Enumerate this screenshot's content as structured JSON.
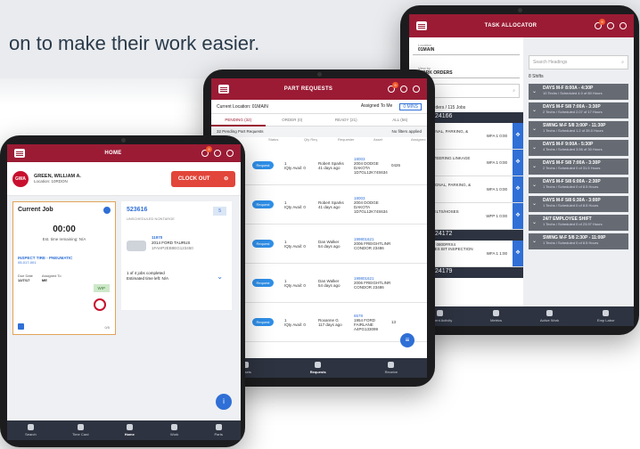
{
  "hero": {
    "text": "on to make their work easier."
  },
  "task_allocator": {
    "title": "TASK ALLOCATOR",
    "location_label": "Location",
    "location_value": "01MAIN",
    "view_by_label": "View by",
    "view_by_value": "WORK ORDERS",
    "search_left": "dings",
    "search_right_placeholder": "Search Headings",
    "work_order_count": "12 Work Orders / 115 Jobs",
    "shifts_count": "8 Shifts",
    "order_ids": [
      "or ID: 524166",
      "or ID: 524172",
      "or ID: 524179"
    ],
    "order_rows": [
      {
        "l1": "FORD E150",
        "l2": "REPAIR SIGNAL, PARKING, &",
        "l3": "WFA 1 0:00"
      },
      {
        "l1": "FORD E150",
        "l2": "INSPECT STEERING LINKAGE",
        "l3": "WFA 1 0:00"
      },
      {
        "l1": "FORD E150",
        "l2": "INSPECT SIGNAL, PARKING, &",
        "l3": "WFA 1 0:00"
      },
      {
        "l1": "FORD E150",
        "l2": "INSPECT BELTS/HOSES",
        "l3": "WFP 1 0:00"
      },
      {
        "l1": "RATOLIGHT 0800FRX4",
        "l2": "PM SERVICES BIT INSPECTION",
        "l3": "WFA 1 1:00"
      }
    ],
    "shifts": [
      {
        "name": "DAYS M-F 8:00A - 4:30P",
        "detail": "10 Techs / Scheduled 4.0 of 80 Hours"
      },
      {
        "name": "DAYS M-F 5/8 7:00A - 3:30P",
        "detail": "2 Techs / Scheduled 2.07 of 17 Hours"
      },
      {
        "name": "SWING M-F 5/8 3:00P - 11:30P",
        "detail": "1 Techs / Scheduled 1.2 of 35.0 Hours"
      },
      {
        "name": "DAYS M-F 9:00A - 5:30P",
        "detail": "4 Techs / Scheduled 3.56 of 30 Hours"
      },
      {
        "name": "DAYS M-F 5/8 7:00A - 3:30P",
        "detail": "2 Techs / Scheduled 0 of 31.5 Hours"
      },
      {
        "name": "DAYS M-F 5/8 6:00A - 2:30P",
        "detail": "1 Techs / Scheduled 0 of 8.5 Hours"
      },
      {
        "name": "DAYS M-F 5/8 6:30A - 3:00P",
        "detail": "1 Techs / Scheduled 0 of 8.5 Hours"
      },
      {
        "name": "24/7 EMPLOYEE SHIFT",
        "detail": "1 Techs / Scheduled 0 of 23.97 Hours"
      },
      {
        "name": "SWING M-F 5/8 2:30P - 11:00P",
        "detail": "1 Techs / Scheduled 0 of 8.5 Hours"
      }
    ],
    "nav": [
      "Current Activity",
      "Metrics",
      "Active Work",
      "Emp Labor"
    ]
  },
  "part_requests": {
    "title": "PART REQUESTS",
    "location": "Current Location: 01MAIN",
    "assigned": "Assigned To Me",
    "sync": "0 MINS",
    "tabs": [
      "PENDING (32)",
      "ORDER (0)",
      "READY (21)",
      "ALL (56)"
    ],
    "sub_left": "32 Pending Part Requests",
    "sub_right": "No filters applied",
    "headers": [
      "Status",
      "Qty Req",
      "Requester",
      "Asset",
      "Assigned"
    ],
    "rows": [
      {
        "status": "Request",
        "qty": "1",
        "avail": "IQty Avail: 0",
        "req": "Robert Sparks",
        "age": "41 days ago",
        "asset": "18003",
        "asset2": "2004 DODGE DAKOTA 1D7GL12K74S634",
        "assigned": "0426"
      },
      {
        "status": "Request",
        "qty": "1",
        "avail": "IQty Avail: 0",
        "req": "Robert Sparks",
        "age": "41 days ago",
        "asset": "18003",
        "asset2": "2004 DODGE DAKOTA 1D7GL12K74S634",
        "assigned": ""
      },
      {
        "status": "Request",
        "qty": "1",
        "avail": "IQty Avail: 0",
        "req": "Dan Walker",
        "age": "54 days ago",
        "asset": "199801621",
        "asset2": "2006 FREIGHTLINR CONDOR 23486",
        "assigned": ""
      },
      {
        "status": "Request",
        "qty": "1",
        "avail": "IQty Avail: 0",
        "req": "Dan Walker",
        "age": "54 days ago",
        "asset": "199801621",
        "asset2": "2006 FREIGHTLINR CONDOR 23486",
        "assigned": ""
      },
      {
        "status": "Request",
        "qty": "1",
        "avail": "IQty Avail: 0",
        "req": "Roxanne G",
        "age": "117 days ago",
        "asset": "6578",
        "asset2": "1954 FORD FAIRLANE A4PG133099",
        "assigned": "13"
      }
    ],
    "nav": [
      "Assets",
      "Requests",
      "Receive"
    ]
  },
  "home": {
    "title": "HOME",
    "initials": "GWA",
    "name": "GREEN, WILLIAM A.",
    "location": "Location: 10RDON",
    "clockout": "CLOCK OUT",
    "current_job_title": "Current Job",
    "time": "00:00",
    "remaining": "Est. time remaining: N/A",
    "task": "INSPECT TIRE - PNEUMATIC",
    "task_code": "05-017-001",
    "wip": "WIP",
    "due_label": "Due Date",
    "due": "12/7/17",
    "assigned_label": "Assigned To",
    "assigned": "ME",
    "count": "0/5",
    "job_number": "523616",
    "job_badge": "5",
    "job_status": "UNSCHEDULED NONTARGE",
    "vehicle_id": "11970",
    "vehicle": "2014 FORD TAURUS",
    "vin": "1FAHP2EB9EG123450",
    "jobs_done": "1 of 4 jobs completed",
    "est": "Estimated time left: N/A",
    "nav": [
      "Search",
      "Time Card",
      "Home",
      "Work",
      "Parts"
    ]
  }
}
